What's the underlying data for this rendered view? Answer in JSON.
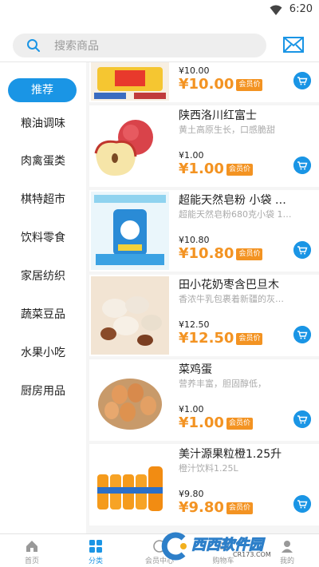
{
  "status_bar": {
    "time": "6:20",
    "wifi_icon": "wifi-icon"
  },
  "search": {
    "placeholder": "搜索商品",
    "icon": "search-icon"
  },
  "header": {
    "mail_icon": "mail-icon"
  },
  "colors": {
    "accent": "#1a95e5",
    "price": "#f39322"
  },
  "categories": [
    {
      "label": "推荐",
      "active": true
    },
    {
      "label": "粮油调味"
    },
    {
      "label": "肉禽蛋类"
    },
    {
      "label": "棋特超市"
    },
    {
      "label": "饮料零食"
    },
    {
      "label": "家居纺织"
    },
    {
      "label": "蔬菜豆品"
    },
    {
      "label": "水果小吃"
    },
    {
      "label": "厨房用品"
    }
  ],
  "products": [
    {
      "name": "",
      "desc": "",
      "price": "¥10.00",
      "vip_price": "¥10.00",
      "vip_label": "会员价"
    },
    {
      "name": "陕西洛川红富士",
      "desc": "黄土高原生长，口感脆甜",
      "price": "¥1.00",
      "vip_price": "¥1.00",
      "vip_label": "会员价"
    },
    {
      "name": "超能天然皂粉 小袋 …",
      "desc": "超能天然皂粉680克小袋 1…",
      "price": "¥10.80",
      "vip_price": "¥10.80",
      "vip_label": "会员价"
    },
    {
      "name": "田小花奶枣含巴旦木",
      "desc": "香浓牛乳包裹着新疆的灰…",
      "price": "¥12.50",
      "vip_price": "¥12.50",
      "vip_label": "会员价"
    },
    {
      "name": "菜鸡蛋",
      "desc": "营养丰富，胆固醇低，",
      "price": "¥1.00",
      "vip_price": "¥1.00",
      "vip_label": "会员价"
    },
    {
      "name": "美汁源果粒橙1.25升",
      "desc": "橙汁饮料1.25L",
      "price": "¥9.80",
      "vip_price": "¥9.80",
      "vip_label": "会员价"
    }
  ],
  "tabs": [
    {
      "label": "首页",
      "icon": "home-icon"
    },
    {
      "label": "分类",
      "icon": "grid-icon",
      "active": true
    },
    {
      "label": "会员中心",
      "icon": "member-icon"
    },
    {
      "label": "购物车",
      "icon": "cart-icon"
    },
    {
      "label": "我的",
      "icon": "user-icon"
    }
  ],
  "watermark": {
    "text": "西西软件园",
    "url": "CR173.COM"
  }
}
